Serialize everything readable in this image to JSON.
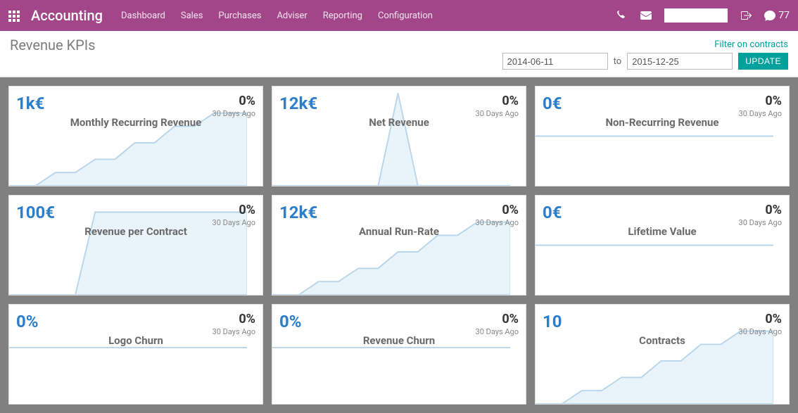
{
  "navbar": {
    "app_title": "Accounting",
    "menu": [
      "Dashboard",
      "Sales",
      "Purchases",
      "Adviser",
      "Reporting",
      "Configuration"
    ],
    "search_placeholder": "",
    "search_value": "",
    "notif_count": "77"
  },
  "control": {
    "page_title": "Revenue KPIs",
    "filter_link": "Filter on contracts",
    "date_from": "2014-06-11",
    "date_to": "2015-12-25",
    "to_label": "to",
    "update_label": "UPDATE"
  },
  "cards": [
    {
      "value": "1k€",
      "label": "Monthly Recurring Revenue",
      "delta": "0%",
      "ago": "30 Days Ago",
      "spark": "step"
    },
    {
      "value": "12k€",
      "label": "Net Revenue",
      "delta": "0%",
      "ago": "30 Days Ago",
      "spark": "spike"
    },
    {
      "value": "0€",
      "label": "Non-Recurring Revenue",
      "delta": "0%",
      "ago": "30 Days Ago",
      "spark": "flat"
    },
    {
      "value": "100€",
      "label": "Revenue per Contract",
      "delta": "0%",
      "ago": "30 Days Ago",
      "spark": "plateau"
    },
    {
      "value": "12k€",
      "label": "Annual Run-Rate",
      "delta": "0%",
      "ago": "30 Days Ago",
      "spark": "step"
    },
    {
      "value": "0€",
      "label": "Lifetime Value",
      "delta": "0%",
      "ago": "30 Days Ago",
      "spark": "flat"
    },
    {
      "value": "0%",
      "label": "Logo Churn",
      "delta": "0%",
      "ago": "30 Days Ago",
      "spark": "flat"
    },
    {
      "value": "0%",
      "label": "Revenue Churn",
      "delta": "0%",
      "ago": "30 Days Ago",
      "spark": "flat"
    },
    {
      "value": "10",
      "label": "Contracts",
      "delta": "0%",
      "ago": "30 Days Ago",
      "spark": "step"
    }
  ],
  "colors": {
    "accent": "#a24689",
    "link": "#00a09d",
    "kpi": "#2c7ecb",
    "spark_stroke": "#b7d5eb",
    "spark_fill": "#e9f3fa"
  }
}
